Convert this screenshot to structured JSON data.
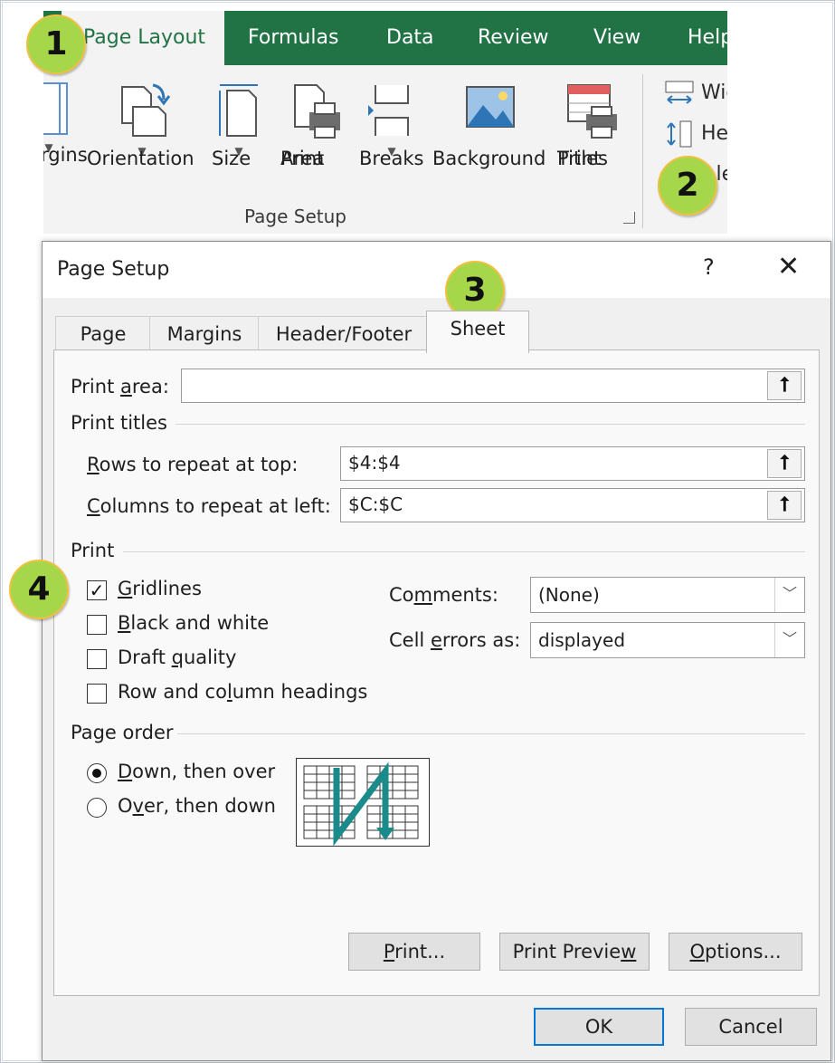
{
  "ribbon": {
    "tabs": [
      {
        "label": "Page Layout",
        "active": true
      },
      {
        "label": "Formulas"
      },
      {
        "label": "Data"
      },
      {
        "label": "Review"
      },
      {
        "label": "View"
      },
      {
        "label": "Help"
      }
    ],
    "commands": {
      "margins": "Margins",
      "orientation": "Orientation",
      "size": "Size",
      "print_area_1": "Print",
      "print_area_2": "Area",
      "breaks": "Breaks",
      "background": "Background",
      "print_titles_1": "Print",
      "print_titles_2": "Titles"
    },
    "group_label": "Page Setup",
    "scale_group": {
      "width": "Width",
      "height": "Height",
      "scale": "Scale"
    },
    "accent_color": "#217346"
  },
  "callouts": [
    "1",
    "2",
    "3",
    "4"
  ],
  "dialog": {
    "title": "Page Setup",
    "help": "?",
    "close": "✕",
    "tabs": [
      "Page",
      "Margins",
      "Header/Footer",
      "Sheet"
    ],
    "active_tab": "Sheet",
    "print_area": {
      "pre": "Print ",
      "key": "a",
      "post": "rea:",
      "value": ""
    },
    "print_titles": {
      "heading": "Print titles",
      "rows": {
        "key": "R",
        "post": "ows to repeat at top:",
        "value": "$4:$4"
      },
      "cols": {
        "key": "C",
        "post": "olumns to repeat at left:",
        "value": "$C:$C"
      }
    },
    "print": {
      "heading": "Print",
      "gridlines": {
        "key": "G",
        "post": "ridlines",
        "checked": true
      },
      "black_white": {
        "key": "B",
        "post": "lack and white",
        "checked": false
      },
      "draft": {
        "pre": "Draft ",
        "key": "q",
        "post": "uality",
        "checked": false
      },
      "headings": {
        "pre": "Row and co",
        "key": "l",
        "post": "umn headings",
        "checked": false
      },
      "comments": {
        "pre": "Co",
        "key": "m",
        "post": "ments:",
        "value": "(None)"
      },
      "cell_errors": {
        "pre": "Cell ",
        "key": "e",
        "post": "rrors as:",
        "value": "displayed"
      }
    },
    "page_order": {
      "heading": "Page order",
      "down_over": {
        "key": "D",
        "post": "own, then over",
        "selected": true
      },
      "over_down": {
        "pre": "O",
        "key": "v",
        "post": "er, then down",
        "selected": false
      }
    },
    "buttons": {
      "print": {
        "key": "P",
        "post": "rint..."
      },
      "preview": {
        "pre": "Print Previe",
        "key": "w"
      },
      "options": {
        "key": "O",
        "post": "ptions..."
      },
      "ok": "OK",
      "cancel": "Cancel"
    },
    "arrow_color": "#1a8a8a"
  }
}
